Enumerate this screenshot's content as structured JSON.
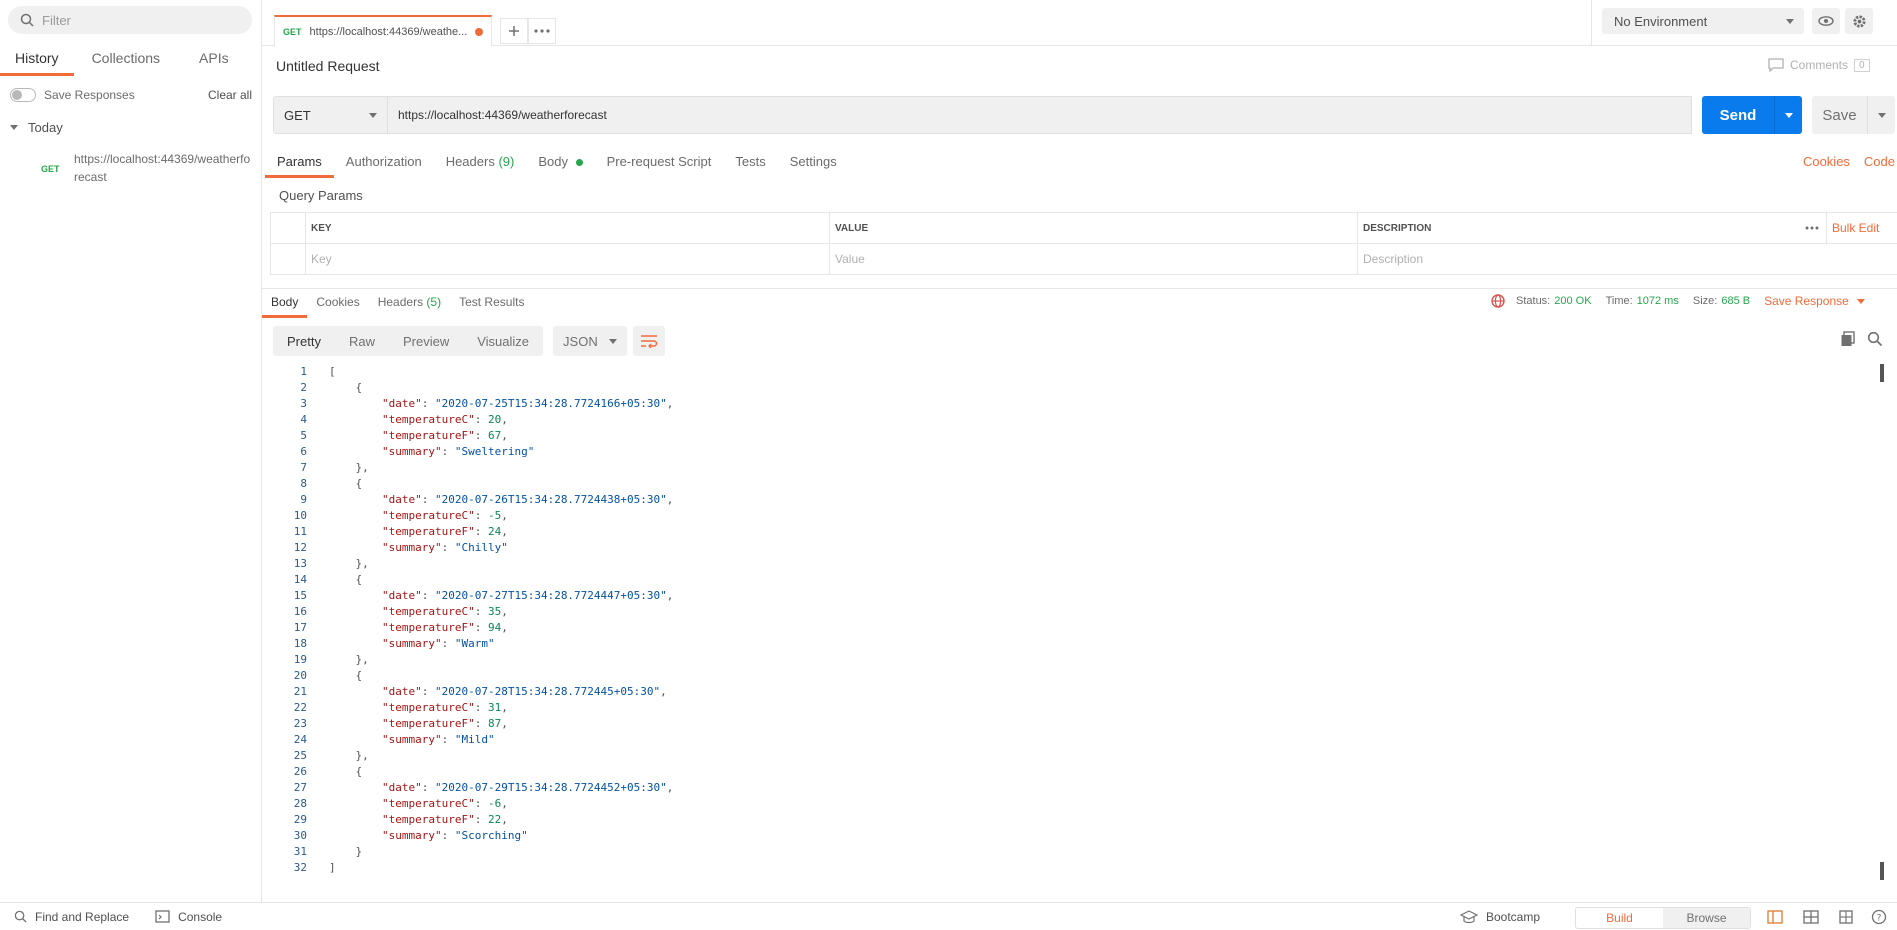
{
  "sidebar": {
    "filter_placeholder": "Filter",
    "tabs": [
      "History",
      "Collections",
      "APIs"
    ],
    "save_responses": "Save Responses",
    "clear_all": "Clear all",
    "group": "Today",
    "history": [
      {
        "method": "GET",
        "url": "https://localhost:44369/weatherforecast"
      }
    ]
  },
  "tabbar": {
    "tab_method": "GET",
    "tab_url": "https://localhost:44369/weathe...",
    "environment": "No Environment"
  },
  "request": {
    "title": "Untitled Request",
    "comments_label": "Comments",
    "comments_count": "0",
    "method": "GET",
    "url": "https://localhost:44369/weatherforecast",
    "send": "Send",
    "save": "Save",
    "tabs": {
      "params": "Params",
      "authorization": "Authorization",
      "headers": "Headers",
      "headers_count": "(9)",
      "body": "Body",
      "prerequest": "Pre-request Script",
      "tests": "Tests",
      "settings": "Settings"
    },
    "cookies": "Cookies",
    "code": "Code",
    "query_params_title": "Query Params",
    "table": {
      "headers": [
        "KEY",
        "VALUE",
        "DESCRIPTION"
      ],
      "bulk_edit": "Bulk Edit",
      "placeholders": [
        "Key",
        "Value",
        "Description"
      ]
    }
  },
  "response": {
    "tabs": {
      "body": "Body",
      "cookies": "Cookies",
      "headers": "Headers",
      "headers_count": "(5)",
      "test_results": "Test Results"
    },
    "status_label": "Status:",
    "status_value": "200 OK",
    "time_label": "Time:",
    "time_value": "1072 ms",
    "size_label": "Size:",
    "size_value": "685 B",
    "save_response": "Save Response",
    "views": [
      "Pretty",
      "Raw",
      "Preview",
      "Visualize"
    ],
    "format": "JSON",
    "items": [
      {
        "date": "2020-07-25T15:34:28.7724166+05:30",
        "temperatureC": "20",
        "temperatureF": "67",
        "summary": "Sweltering"
      },
      {
        "date": "2020-07-26T15:34:28.7724438+05:30",
        "temperatureC": "-5",
        "temperatureF": "24",
        "summary": "Chilly"
      },
      {
        "date": "2020-07-27T15:34:28.7724447+05:30",
        "temperatureC": "35",
        "temperatureF": "94",
        "summary": "Warm"
      },
      {
        "date": "2020-07-28T15:34:28.772445+05:30",
        "temperatureC": "31",
        "temperatureF": "87",
        "summary": "Mild"
      },
      {
        "date": "2020-07-29T15:34:28.7724452+05:30",
        "temperatureC": "-6",
        "temperatureF": "22",
        "summary": "Scorching"
      }
    ]
  },
  "footer": {
    "find_replace": "Find and Replace",
    "console": "Console",
    "bootcamp": "Bootcamp",
    "build": "Build",
    "browse": "Browse"
  },
  "colors": {
    "accent": "#f26b3a",
    "send_blue": "#097bed",
    "success_green": "#26a64b"
  }
}
